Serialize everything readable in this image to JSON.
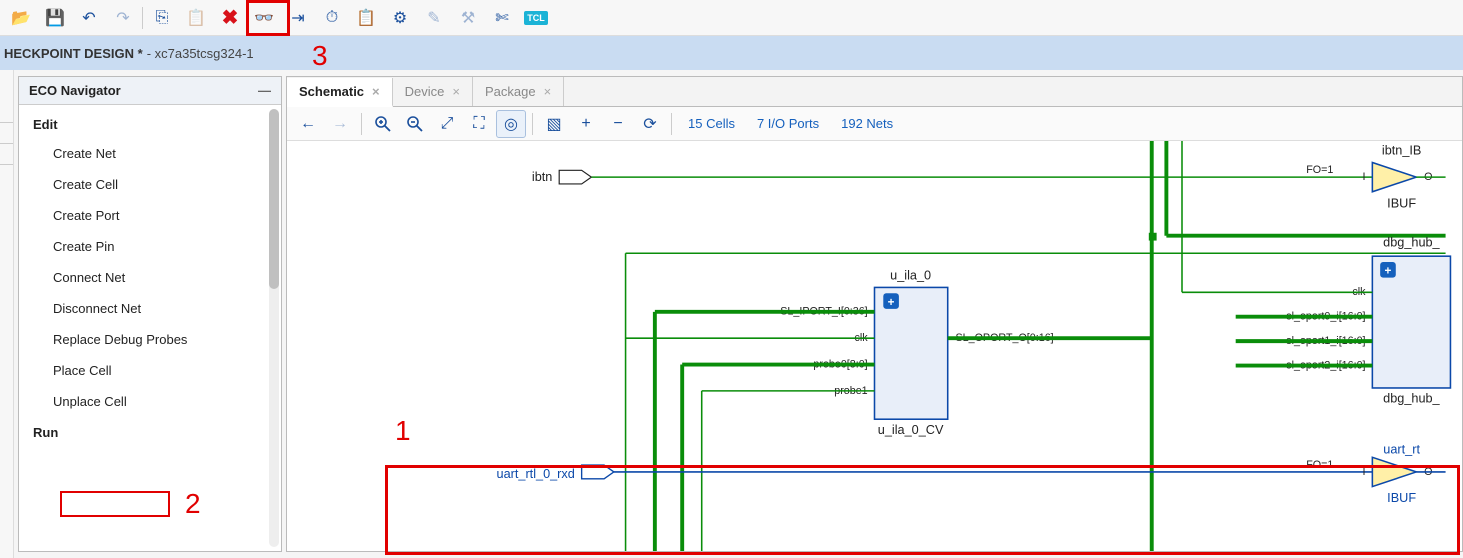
{
  "toolbar": {
    "items": [
      {
        "name": "open-icon",
        "glyph": "📂",
        "disabled": false
      },
      {
        "name": "save-icon",
        "glyph": "💾",
        "disabled": false
      },
      {
        "name": "undo-icon",
        "glyph": "↶",
        "disabled": false
      },
      {
        "name": "redo-icon",
        "glyph": "↷",
        "disabled": true
      },
      {
        "sep": true
      },
      {
        "name": "copy-icon",
        "glyph": "⎘",
        "disabled": false
      },
      {
        "name": "paste-icon",
        "glyph": "📋",
        "disabled": true
      },
      {
        "name": "cancel-icon",
        "glyph": "✖",
        "disabled": false,
        "red": true
      },
      {
        "name": "binoculars-icon",
        "glyph": "👓",
        "disabled": false
      },
      {
        "name": "step-icon",
        "glyph": "⇥",
        "disabled": false
      },
      {
        "name": "timer-icon",
        "glyph": "⏱",
        "disabled": false
      },
      {
        "name": "clipboard-icon",
        "glyph": "📋",
        "disabled": false
      },
      {
        "name": "settings-icon",
        "glyph": "⚙",
        "disabled": false
      },
      {
        "name": "wand-icon",
        "glyph": "✎",
        "disabled": true
      },
      {
        "name": "pencil-icon",
        "glyph": "⚒",
        "disabled": true
      },
      {
        "name": "cut-icon",
        "glyph": "✄",
        "disabled": false,
        "color": "#3a5"
      },
      {
        "name": "tcl-icon",
        "glyph": "TCL",
        "disabled": false,
        "badge": true
      }
    ]
  },
  "title": {
    "main": "HECKPOINT DESIGN *",
    "sub": " - xc7a35tcsg324-1"
  },
  "callouts": {
    "one": "1",
    "two": "2",
    "three": "3"
  },
  "sidebar": {
    "title": "ECO Navigator",
    "sections": [
      {
        "head": "Edit",
        "items": [
          {
            "label": "Create Net"
          },
          {
            "label": "Create Cell"
          },
          {
            "label": "Create Port"
          },
          {
            "label": "Create Pin"
          },
          {
            "label": "Connect Net"
          },
          {
            "label": "Disconnect Net"
          },
          {
            "label": "Replace Debug Probes"
          },
          {
            "label": "Place Cell"
          },
          {
            "label": "Unplace Cell",
            "boxed": true
          }
        ]
      },
      {
        "head": "Run",
        "items": []
      }
    ]
  },
  "tabs": [
    {
      "label": "Schematic",
      "active": true
    },
    {
      "label": "Device",
      "active": false
    },
    {
      "label": "Package",
      "active": false
    }
  ],
  "sch_toolbar": {
    "stats": {
      "cells": "15 Cells",
      "ports": "7 I/O Ports",
      "nets": "192 Nets"
    }
  },
  "schematic": {
    "ports": {
      "ibtn": "ibtn",
      "uart": "uart_rtl_0_rxd"
    },
    "u_ila_0": {
      "name_top": "u_ila_0",
      "name_bot": "u_ila_0_CV",
      "pins_left": [
        "SL_IPORT_I[0:36]",
        "clk",
        "probe0[8:0]",
        "probe1"
      ],
      "pins_right": [
        "SL_OPORT_O[0:16]"
      ]
    },
    "dbg_hub": {
      "name_top": "dbg_hub_",
      "name_bot": "dbg_hub_",
      "pins_left": [
        "clk",
        "sl_oport0_i[16:0]",
        "sl_oport1_i[16:0]",
        "sl_oport2_i[16:0]"
      ]
    },
    "ibuf_ibtn": {
      "name_top": "ibtn_IB",
      "name_bot": "IBUF",
      "pin_in": "I",
      "pin_out": "O",
      "fo": "FO=1"
    },
    "ibuf_uart": {
      "name_top": "uart_rt",
      "name_bot": "IBUF",
      "pin_in": "I",
      "pin_out": "O",
      "fo": "FO=1"
    }
  }
}
